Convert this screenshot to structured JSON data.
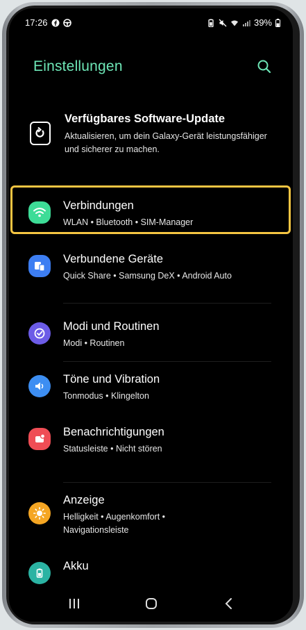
{
  "status_bar": {
    "time": "17:26",
    "battery": "39%"
  },
  "header": {
    "title": "Einstellungen"
  },
  "update": {
    "title": "Verfügbares Software-Update",
    "description": "Aktualisieren, um dein Galaxy-Gerät leistungsfähiger und sicherer zu machen."
  },
  "items": [
    {
      "title": "Verbindungen",
      "subtitle": "WLAN  •  Bluetooth  •  SIM-Manager",
      "icon": "wifi-icon",
      "color": "#3ddc97"
    },
    {
      "title": "Verbundene Geräte",
      "subtitle": "Quick Share  •  Samsung DeX  •  Android Auto",
      "icon": "devices-icon",
      "color": "#3d7ef2"
    },
    {
      "title": "Modi und Routinen",
      "subtitle": "Modi  •  Routinen",
      "icon": "routine-check-icon",
      "color": "#6c5ce7"
    },
    {
      "title": "Töne und Vibration",
      "subtitle": "Tonmodus  •  Klingelton",
      "icon": "speaker-icon",
      "color": "#3d8ef2"
    },
    {
      "title": "Benachrichtigungen",
      "subtitle": "Statusleiste  •  Nicht stören",
      "icon": "notification-icon",
      "color": "#ef4d55"
    },
    {
      "title": "Anzeige",
      "subtitle": "Helligkeit  •  Augenkomfort  •  Navigationsleiste",
      "icon": "sun-icon",
      "color": "#f5a623"
    },
    {
      "title": "Akku",
      "subtitle": "",
      "icon": "battery-icon",
      "color": "#2bb3a3"
    }
  ]
}
